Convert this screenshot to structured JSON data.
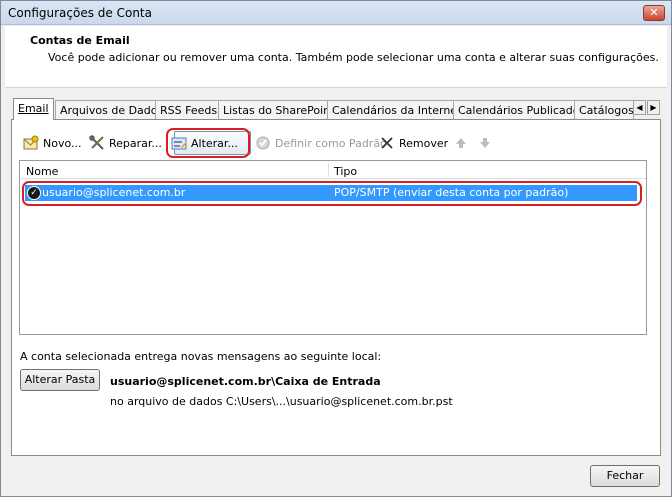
{
  "window": {
    "title": "Configurações de Conta"
  },
  "header": {
    "title": "Contas de Email",
    "description": "Você pode adicionar ou remover uma conta. Também pode selecionar uma conta e alterar suas configurações."
  },
  "tabs": [
    {
      "label": "Email",
      "active": true
    },
    {
      "label": "Arquivos de Dados"
    },
    {
      "label": "RSS Feeds"
    },
    {
      "label": "Listas do SharePoint"
    },
    {
      "label": "Calendários da Internet"
    },
    {
      "label": "Calendários Publicados"
    },
    {
      "label": "Catálogos"
    }
  ],
  "toolbar": {
    "new_label": "Novo...",
    "repair_label": "Reparar...",
    "change_label": "Alterar...",
    "set_default_label": "Definir como Padrão",
    "remove_label": "Remover"
  },
  "list": {
    "columns": {
      "name": "Nome",
      "type": "Tipo"
    },
    "rows": [
      {
        "name": "usuario@splicenet.com.br",
        "type": "POP/SMTP (enviar desta conta por padrão)"
      }
    ]
  },
  "delivery": {
    "label": "A conta selecionada entrega novas mensagens ao seguinte local:",
    "button_label": "Alterar Pasta",
    "target": "usuario@splicenet.com.br\\Caixa de Entrada",
    "file": "no arquivo de dados C:\\Users\\...\\usuario@splicenet.com.br.pst"
  },
  "footer": {
    "close_label": "Fechar"
  },
  "colors": {
    "selection": "#3399ff",
    "highlight_ring": "#d72020"
  }
}
